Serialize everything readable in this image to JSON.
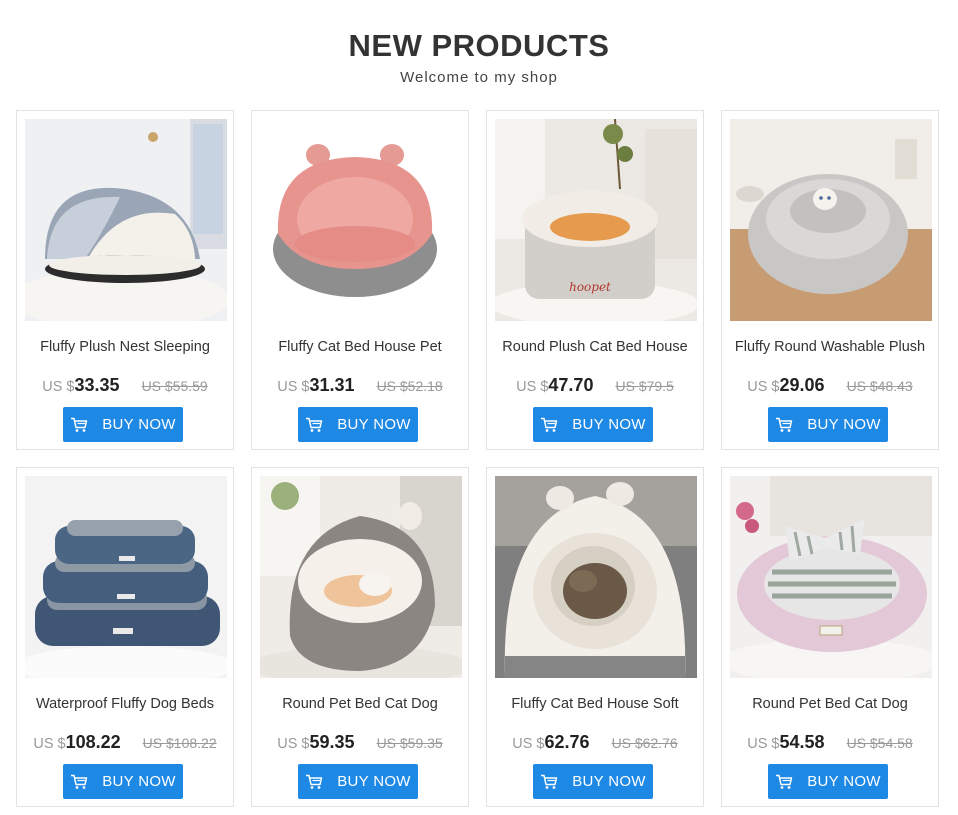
{
  "header": {
    "title": "NEW PRODUCTS",
    "subtitle": "Welcome to my shop"
  },
  "currency_prefix": "US $",
  "button_label": "BUY NOW",
  "button_icon": "shopping-cart-icon",
  "colors": {
    "accent": "#1e88e5",
    "price": "#222222",
    "old_price": "#999999"
  },
  "products": [
    {
      "name": "Fluffy Plush Nest Sleeping",
      "currency": "US $",
      "price": "33.35",
      "old_price": "US $55.59",
      "button": "BUY NOW"
    },
    {
      "name": "Fluffy Cat Bed House Pet",
      "currency": "US $",
      "price": "31.31",
      "old_price": "US $52.18",
      "button": "BUY NOW"
    },
    {
      "name": "Round Plush Cat Bed House",
      "currency": "US $",
      "price": "47.70",
      "old_price": "US $79.5",
      "button": "BUY NOW"
    },
    {
      "name": "Fluffy Round Washable Plush",
      "currency": "US $",
      "price": "29.06",
      "old_price": "US $48.43",
      "button": "BUY NOW"
    },
    {
      "name": "Waterproof Fluffy Dog Beds",
      "currency": "US $",
      "price": "108.22",
      "old_price": "US $108.22",
      "button": "BUY NOW"
    },
    {
      "name": "Round Pet Bed Cat Dog",
      "currency": "US $",
      "price": "59.35",
      "old_price": "US $59.35",
      "button": "BUY NOW"
    },
    {
      "name": "Fluffy Cat Bed House Soft",
      "currency": "US $",
      "price": "62.76",
      "old_price": "US $62.76",
      "button": "BUY NOW"
    },
    {
      "name": "Round Pet Bed Cat Dog",
      "currency": "US $",
      "price": "54.58",
      "old_price": "US $54.58",
      "button": "BUY NOW"
    }
  ]
}
